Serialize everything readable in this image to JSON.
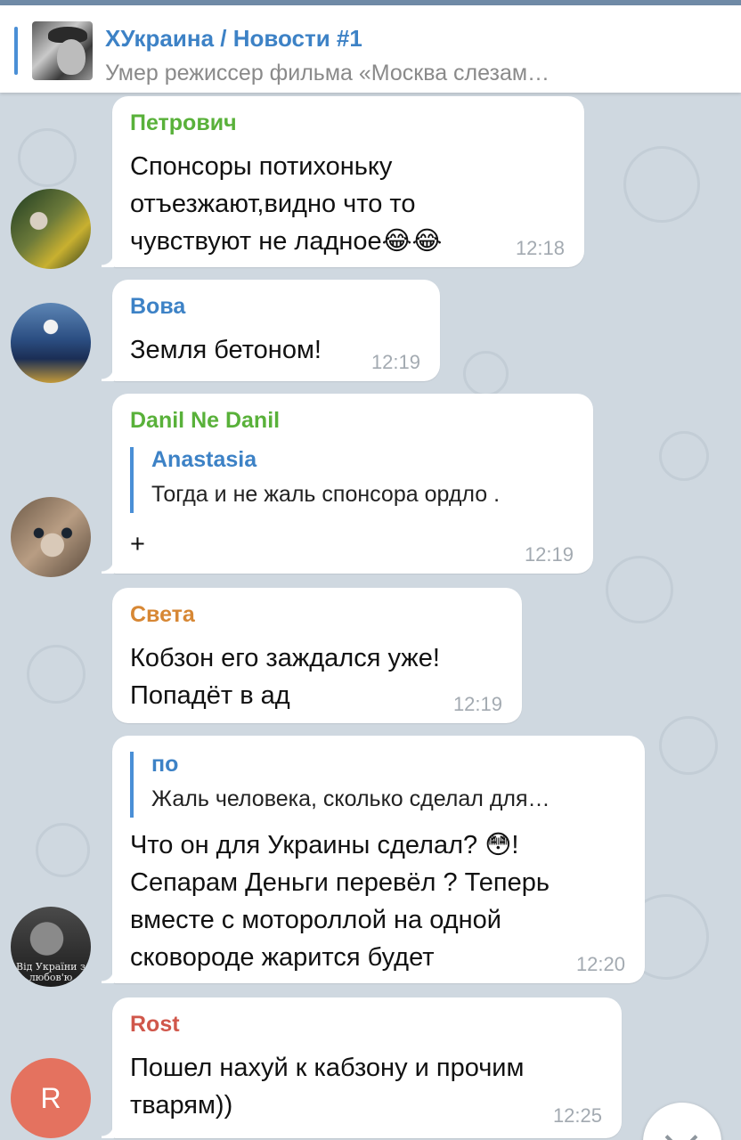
{
  "pinned": {
    "title": "ХУкраина / Новости #1",
    "subtitle": "Умер режиссер фильма «Москва слезам…"
  },
  "colors": {
    "accent": "#3d82c6",
    "petrovich": "#59b13a",
    "vova": "#3d82c6",
    "danil": "#59b13a",
    "sveta": "#d78734",
    "rost": "#d0574b",
    "avatar_r": "#e4725f"
  },
  "messages": [
    {
      "sender": "Петрович",
      "text": "Спонсоры потихоньку\nотъезжают,видно что то\nчувствуют не ладное😂😂",
      "time": "12:18"
    },
    {
      "sender": "Вова",
      "text": "Земля бетоном!",
      "time": "12:19"
    },
    {
      "sender": "Danil Ne Danil",
      "reply_name": "Anastasia",
      "reply_text": "Тогда и не жаль спонсора ордло .",
      "text": "+",
      "time": "12:19"
    },
    {
      "sender": "Света",
      "text": "Кобзон его заждался уже!\nПопадёт в ад",
      "time": "12:19"
    },
    {
      "reply_name": "по",
      "reply_text": "Жаль человека, сколько сделал для…",
      "text": "Что он для Украины сделал? 😳!\nСепарам Деньги перевёл ? Теперь\nвместе с мотороллой на одной\nсковороде жарится будет",
      "time": "12:20"
    },
    {
      "sender": "Rost",
      "text": "Пошел нахуй к кабзону и прочим\nтварям))",
      "time": "12:25"
    }
  ],
  "avatars": {
    "d_caption": "Від України з любов'ю",
    "r_initial": "R"
  }
}
